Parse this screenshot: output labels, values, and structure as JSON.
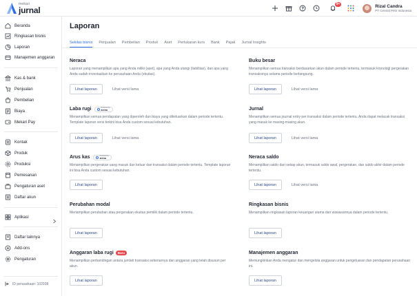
{
  "app": {
    "logo_sub": "mekari",
    "logo_main": "jurnal"
  },
  "user": {
    "name": "Rizal Candra",
    "company": "PT Central Petir Indonesia",
    "notif_count": "9+"
  },
  "sidebar": {
    "items": [
      {
        "label": "Beranda",
        "icon": "home-icon"
      },
      {
        "label": "Ringkasan bisnis",
        "icon": "chart-icon"
      },
      {
        "label": "Laporan",
        "icon": "report-icon"
      },
      {
        "label": "Manajemen anggaran",
        "icon": "budget-icon"
      },
      {
        "label": "Kas & bank",
        "icon": "bank-icon"
      },
      {
        "label": "Penjualan",
        "icon": "sales-icon"
      },
      {
        "label": "Pembelian",
        "icon": "purchase-icon"
      },
      {
        "label": "Biaya",
        "icon": "expense-icon"
      },
      {
        "label": "Mekari Pay",
        "icon": "pay-icon"
      },
      {
        "label": "Kontak",
        "icon": "contact-icon"
      },
      {
        "label": "Produk",
        "icon": "product-icon"
      },
      {
        "label": "Produksi",
        "icon": "production-icon"
      },
      {
        "label": "Pemesanan",
        "icon": "order-icon"
      },
      {
        "label": "Pengaturan aset",
        "icon": "asset-icon"
      },
      {
        "label": "Daftar akun",
        "icon": "accounts-icon"
      },
      {
        "label": "Aplikasi",
        "icon": "apps-icon"
      },
      {
        "label": "Daftar lainnya",
        "icon": "list-icon"
      },
      {
        "label": "Add-ons",
        "icon": "addons-icon"
      },
      {
        "label": "Pengaturan",
        "icon": "settings-icon"
      }
    ],
    "company_id": "ID perusahaan: 102938"
  },
  "main": {
    "title": "Laporan",
    "tabs": [
      {
        "label": "Sekilas bisnis",
        "active": true
      },
      {
        "label": "Penjualan"
      },
      {
        "label": "Pembelian"
      },
      {
        "label": "Produk"
      },
      {
        "label": "Aset"
      },
      {
        "label": "Pertukaran kurs"
      },
      {
        "label": "Bank"
      },
      {
        "label": "Pajak"
      },
      {
        "label": "Jurnal Insights"
      }
    ],
    "view_report_label": "Lihat laporan",
    "old_version_label": "Lihat versi lama",
    "arena_badge": {
      "small": "Powered by",
      "big": "arena"
    },
    "new_badge": "Baru",
    "cards": [
      {
        "title": "Neraca",
        "desc": "Laporan yang menampilkan apa yang Anda miliki (aset), apa yang Anda utangi (liabilitas), dan apa yang Anda sudah investasikan ke perusahaan Anda (ekuitas)."
      },
      {
        "title": "Buku besar",
        "desc": "Menampilkan semua transaksi berdasarkan akun dalam periode tertentu, termasuk kronologi pergerakan transaksinya selama periode berlangsung."
      },
      {
        "title": "Laba rugi",
        "desc": "Menampilkan semua pendapatan yang diperoleh dan biaya yang dikeluarkan dalam periode tertentu. Template laporan versi terkini bisa Anda custom sesuai kebutuhan."
      },
      {
        "title": "Jurnal",
        "desc": "Menampilkan semua journal entry per transaksi dalam periode tertentu. Anda dapat melacak transaksi yang masuk ke masing-masing akun."
      },
      {
        "title": "Arus kas",
        "desc": "Menampilkan pergerakan uang masuk dan keluar dari transaksi dalam periode tertentu. Template laporan ini bisa Anda custom sesuai kebutuhan."
      },
      {
        "title": "Neraca saldo",
        "desc": "Menampilkan saldo dari setiap akun, termasuk saldo awal, pergerakan, dan saldo akhir dalam periode tertentu."
      },
      {
        "title": "Perubahan modal",
        "desc": "Menampilkan perubahan atau pergerakan ekuitas pemilik dalam periode tertentu."
      },
      {
        "title": "Ringkasan bisnis",
        "desc": "Menampilkan ringkasan laporan keuangan utama dan wawasannya dalam periode tertentu."
      },
      {
        "title": "Anggaran laba rugi",
        "desc": "Menampilkan perbandingan antara jumlah transaksi sebenarnya dan anggaran yang telah disusun per akun."
      },
      {
        "title": "Manajemen anggaran",
        "desc": "Memungkinkan Anda mengatur dan mengelola anggaran untuk pengeluaran dan pendapatan perusahaan ini."
      }
    ]
  }
}
